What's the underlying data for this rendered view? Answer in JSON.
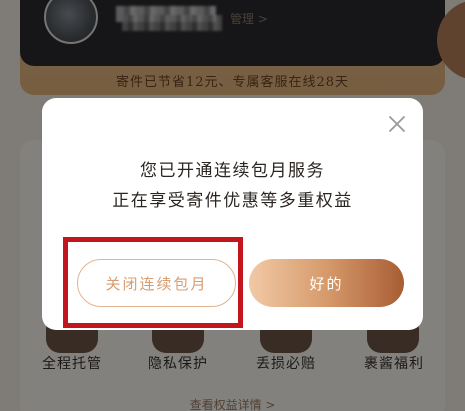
{
  "background": {
    "member_card": {
      "manage_link": "管理 >",
      "stats": "寄件已节省12元、专属客服在线28天"
    },
    "benefits": [
      {
        "label": "全程托管",
        "icon": "custody-icon"
      },
      {
        "label": "隐私保护",
        "icon": "privacy-shield-icon"
      },
      {
        "label": "丢损必赔",
        "icon": "compensation-icon"
      },
      {
        "label": "裹酱福利",
        "icon": "gift-icon"
      }
    ],
    "view_details": "查看权益详情 >"
  },
  "dialog": {
    "title": "您已开通连续包月服务",
    "subtitle": "正在享受寄件优惠等多重权益",
    "cancel_label": "关闭连续包月",
    "ok_label": "好的",
    "close_icon": "close-icon"
  },
  "colors": {
    "highlight_border": "#c3161c",
    "cancel_text": "#d89d70",
    "ok_gradient_start": "#f1c9a5",
    "ok_gradient_end": "#a85d34"
  }
}
